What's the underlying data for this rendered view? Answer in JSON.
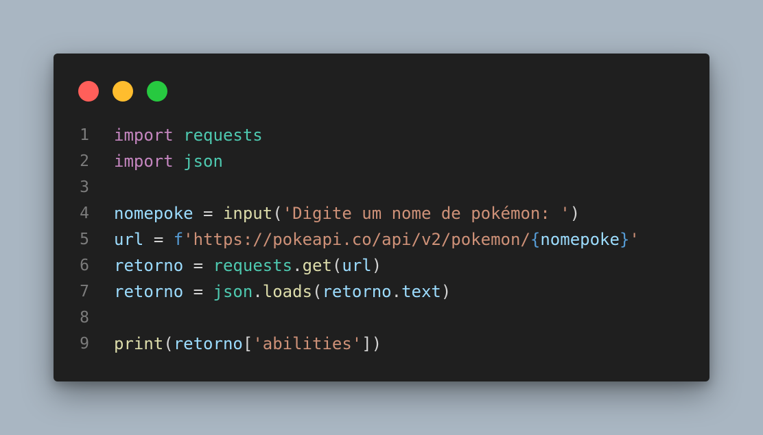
{
  "window": {
    "controls": [
      "close",
      "minimize",
      "maximize"
    ]
  },
  "line_numbers": [
    "1",
    "2",
    "3",
    "4",
    "5",
    "6",
    "7",
    "8",
    "9"
  ],
  "lines": {
    "l1": {
      "kw": "import",
      "mod": "requests"
    },
    "l2": {
      "kw": "import",
      "mod": "json"
    },
    "l4": {
      "var": "nomepoke",
      "op": "=",
      "fn": "input",
      "open": "(",
      "str": "'Digite um nome de pokémon: '",
      "close": ")"
    },
    "l5": {
      "var": "url",
      "op": "=",
      "prefix": "f",
      "str": "'https://pokeapi.co/api/v2/pokemon/",
      "brace_open": "{",
      "interp": "nomepoke",
      "brace_close": "}",
      "str_end": "'"
    },
    "l6": {
      "var": "retorno",
      "op": "=",
      "mod": "requests",
      "dot": ".",
      "fn": "get",
      "open": "(",
      "arg": "url",
      "close": ")"
    },
    "l7": {
      "var": "retorno",
      "op": "=",
      "mod": "json",
      "dot": ".",
      "fn": "loads",
      "open": "(",
      "arg": "retorno",
      "dot2": ".",
      "attr": "text",
      "close": ")"
    },
    "l9": {
      "fn": "print",
      "open": "(",
      "var": "retorno",
      "bopen": "[",
      "str": "'abilities'",
      "bclose": "]",
      "close": ")"
    }
  }
}
